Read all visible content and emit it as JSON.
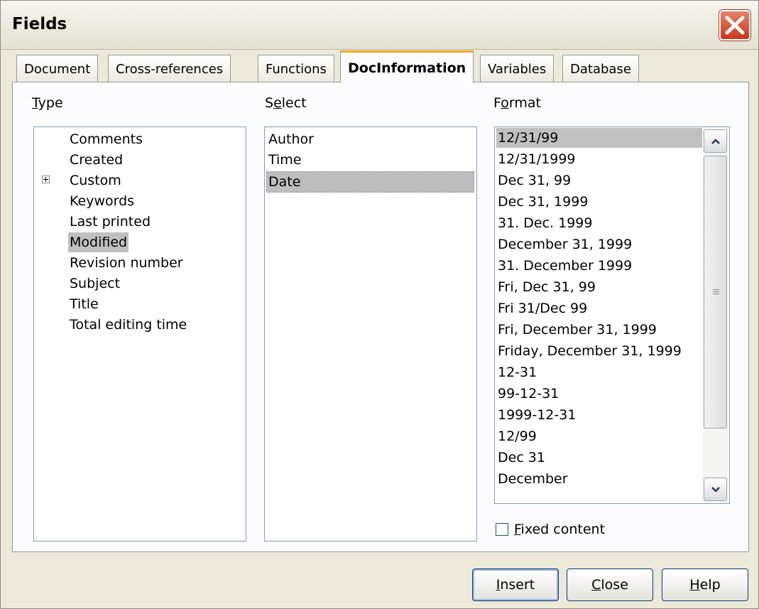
{
  "window": {
    "title": "Fields"
  },
  "tabs": [
    {
      "label": "Document"
    },
    {
      "label": "Cross-references"
    },
    {
      "label": "Functions"
    },
    {
      "label": "DocInformation",
      "active": true
    },
    {
      "label": "Variables"
    },
    {
      "label": "Database"
    }
  ],
  "type": {
    "label_first": "T",
    "label_rest": "ype",
    "items": [
      "Comments",
      "Created",
      "Custom",
      "Keywords",
      "Last printed",
      "Modified",
      "Revision number",
      "Subject",
      "Title",
      "Total editing time"
    ],
    "selected": "Modified"
  },
  "select": {
    "label_first": "S",
    "label_u": "e",
    "label_rest": "lect",
    "items": [
      "Author",
      "Time",
      "Date"
    ],
    "selected": "Date"
  },
  "format": {
    "label_first": "F",
    "label_u": "o",
    "label_rest": "rmat",
    "items": [
      "12/31/99",
      "12/31/1999",
      "Dec 31, 99",
      "Dec 31, 1999",
      "31. Dec. 1999",
      "December 31, 1999",
      "31. December 1999",
      "Fri, Dec 31, 99",
      "Fri 31/Dec 99",
      "Fri, December 31, 1999",
      "Friday, December 31, 1999",
      "12-31",
      "99-12-31",
      "1999-12-31",
      "12/99",
      "Dec 31",
      "December"
    ],
    "selected": "12/31/99"
  },
  "fixed_content": {
    "u": "F",
    "rest": "ixed content",
    "checked": false
  },
  "buttons": {
    "insert": {
      "u": "I",
      "rest": "nsert"
    },
    "close": {
      "u": "C",
      "rest": "lose"
    },
    "help": {
      "u": "H",
      "rest": "elp"
    }
  },
  "colors": {
    "selection": "#c0c0c0",
    "active_tab_accent": "#f5a623",
    "close_button": "#c9381a"
  }
}
